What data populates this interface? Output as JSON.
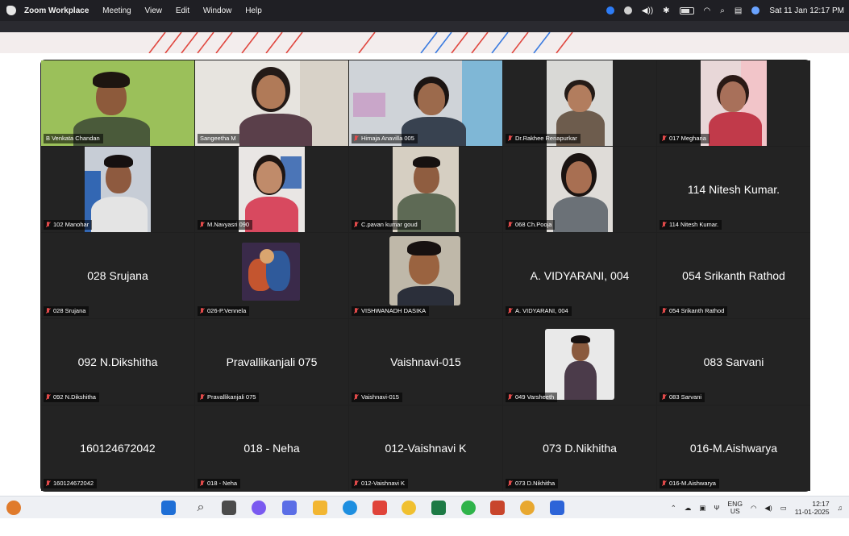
{
  "menubar": {
    "app_name": "Zoom Workplace",
    "menus": [
      "Meeting",
      "View",
      "Edit",
      "Window",
      "Help"
    ],
    "datetime": "Sat 11 Jan  12:17 PM"
  },
  "participants": [
    {
      "name": "B Venkata Chandan",
      "video": true,
      "active": false,
      "muted": false
    },
    {
      "name": "Sangeetha M",
      "video": true,
      "active": true,
      "muted": false
    },
    {
      "name": "Himaja Anavilla 005",
      "video": true,
      "active": false,
      "muted": true
    },
    {
      "name": "Dr.Rakhee Renapurkar",
      "video": true,
      "active": false,
      "muted": true
    },
    {
      "name": "017 Meghana",
      "video": true,
      "active": false,
      "muted": true
    },
    {
      "name": "102 Manohar",
      "video": true,
      "active": false,
      "muted": true
    },
    {
      "name": "M.Navyasri 090",
      "video": true,
      "active": false,
      "muted": true
    },
    {
      "name": "C.pavan kumar goud",
      "video": true,
      "active": false,
      "muted": true
    },
    {
      "name": "068 Ch.Pooja",
      "video": true,
      "active": false,
      "muted": true
    },
    {
      "name": "114 Nitesh Kumar.",
      "video": false,
      "active": false,
      "muted": true
    },
    {
      "name": "028 Srujana",
      "video": false,
      "active": false,
      "muted": true
    },
    {
      "name": "026-P.Vennela",
      "video": true,
      "active": false,
      "muted": true
    },
    {
      "name": "VISHWANADH DASIKA",
      "video": true,
      "active": false,
      "muted": true
    },
    {
      "name": "A. VIDYARANI, 004",
      "video": false,
      "active": false,
      "muted": true
    },
    {
      "name": "054 Srikanth Rathod",
      "video": false,
      "active": false,
      "muted": true
    },
    {
      "name": "092 N.Dikshitha",
      "video": false,
      "active": false,
      "muted": true
    },
    {
      "name": "Pravallikanjali 075",
      "video": false,
      "active": false,
      "muted": true
    },
    {
      "name": "Vaishnavi-015",
      "video": false,
      "active": false,
      "muted": true
    },
    {
      "name": "049 Varsheeth",
      "video": true,
      "active": false,
      "muted": true
    },
    {
      "name": "083 Sarvani",
      "video": false,
      "active": false,
      "muted": true
    },
    {
      "name": "160124672042",
      "video": false,
      "active": false,
      "muted": true
    },
    {
      "name": "018 - Neha",
      "video": false,
      "active": false,
      "muted": true
    },
    {
      "name": "012-Vaishnavi K",
      "video": false,
      "active": false,
      "muted": true
    },
    {
      "name": "073 D.Nikhitha",
      "video": false,
      "active": false,
      "muted": true
    },
    {
      "name": "016-M.Aishwarya",
      "video": false,
      "active": false,
      "muted": true
    }
  ],
  "taskbar": {
    "lang_top": "ENG",
    "lang_bottom": "US",
    "time": "12:17",
    "date": "11-01-2025"
  },
  "colors": {
    "gallery_bg": "#1f1f1f",
    "active_speaker": "#3fd45a",
    "muted_mic": "#e24a4a"
  }
}
